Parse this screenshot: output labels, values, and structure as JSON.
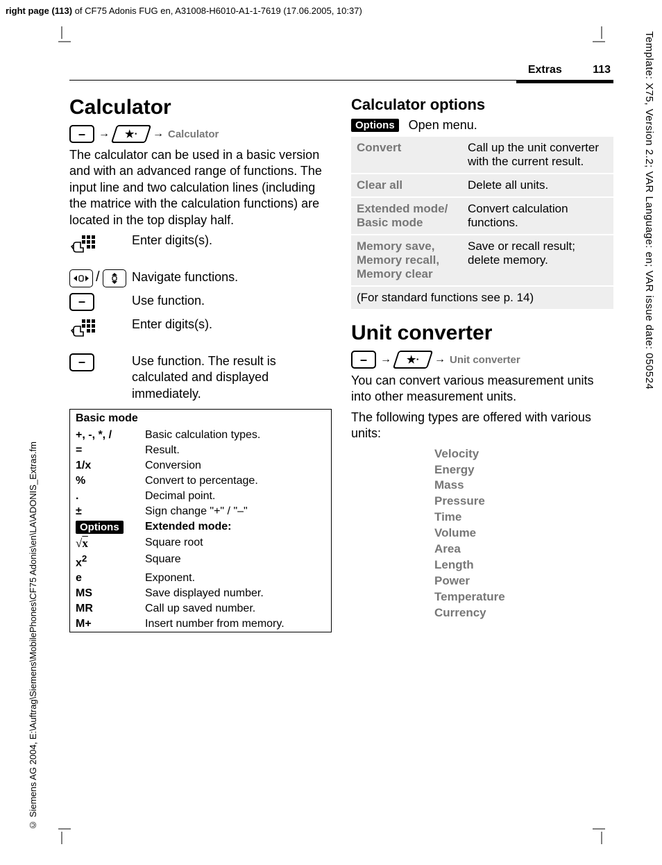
{
  "header": {
    "page_label_prefix": "right page (113)",
    "page_label_rest": " of CF75 Adonis FUG en, A31008-H6010-A1-1-7619 (17.06.2005, 10:37)"
  },
  "side_right": "Template: X75, Version 2.2; VAR Language: en; VAR issue date: 050524",
  "side_left": "© Siemens AG 2004,  E:\\Auftrag\\Siemens\\MobilePhones\\CF75 Adonis\\en\\LA\\ADONIS_Extras.fm",
  "top_labels": {
    "section": "Extras",
    "page": "113"
  },
  "left": {
    "title": "Calculator",
    "nav_target": "Calculator",
    "intro": "The calculator can be used in a basic version and with an advanced range of functions. The input line and two calculation lines (including the matrice with the calculation functions) are located in the top display half.",
    "steps": [
      {
        "text": "Enter digits(s)."
      },
      {
        "text": "Navigate functions."
      },
      {
        "text": "Use function."
      },
      {
        "text": "Enter digits(s)."
      },
      {
        "text": "Use function. The result is calculated and displayed immediately."
      }
    ],
    "basic": {
      "header": "Basic mode",
      "rows": [
        {
          "k": "+, -, *, /",
          "v": "Basic calculation types."
        },
        {
          "k": "=",
          "v": "Result."
        },
        {
          "k": "1/x",
          "v": "Conversion"
        },
        {
          "k": "%",
          "v": "Convert to percentage."
        },
        {
          "k": ".",
          "v": "Decimal point."
        },
        {
          "k": "±",
          "v": "Sign change \"+\" / \"–\""
        }
      ],
      "ext_label": "Extended mode:",
      "ext_rows": [
        {
          "k": "√x",
          "v": "Square root"
        },
        {
          "k": "x²",
          "v": "Square"
        },
        {
          "k": "e",
          "v": "Exponent."
        },
        {
          "k": "MS",
          "v": "Save displayed number."
        },
        {
          "k": "MR",
          "v": "Call up saved number."
        },
        {
          "k": "M+",
          "v": "Insert number from memory."
        }
      ],
      "options_pill": "Options"
    }
  },
  "right": {
    "calc_opts_title": "Calculator options",
    "options_pill": "Options",
    "open_menu": "Open menu.",
    "rows": [
      {
        "k": "Convert",
        "v": "Call up the unit converter with the current result."
      },
      {
        "k": "Clear all",
        "v": "Delete all units."
      },
      {
        "k": "Extended mode/\nBasic mode",
        "v": "Convert calculation functions."
      },
      {
        "k": "Memory save,\nMemory recall,\nMemory clear",
        "v": "Save or recall result; delete memory."
      }
    ],
    "footer": "(For standard functions see p. 14)",
    "unit_title": "Unit converter",
    "unit_nav_target": "Unit converter",
    "unit_intro1": "You can convert various measurement units into other measurement units.",
    "unit_intro2": "The following types are offered with various units:",
    "unit_list": [
      "Velocity",
      "Energy",
      "Mass",
      "Pressure",
      "Time",
      "Volume",
      "Area",
      "Length",
      "Power",
      "Temperature",
      "Currency"
    ]
  }
}
